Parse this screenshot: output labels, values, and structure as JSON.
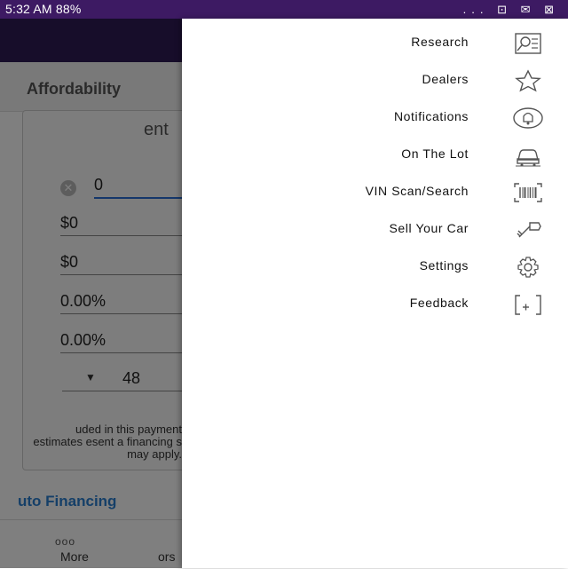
{
  "status_bar": {
    "time": "5:32 AM",
    "battery": "88%",
    "right_icons": "... ⊡ ✉ ⊠"
  },
  "tabs": {
    "affordability": "Affordability"
  },
  "card": {
    "title": "ent",
    "input_value": "0",
    "fields": [
      "$0",
      "$0",
      "0.00%",
      "0.00%"
    ],
    "term": "48"
  },
  "disclaimer": "uded in this payment estimates esent a financing s may apply.",
  "financing_link": "uto Financing",
  "bottom_nav": {
    "more_label": "More",
    "more_dots": "ooo",
    "ors_label": "ors"
  },
  "drawer": {
    "items": [
      {
        "label": "Research",
        "icon": "research-icon"
      },
      {
        "label": "Dealers",
        "icon": "star-icon"
      },
      {
        "label": "Notifications",
        "icon": "bell-icon"
      },
      {
        "label": "On The Lot",
        "icon": "car-lot-icon"
      },
      {
        "label": "VIN Scan/Search",
        "icon": "barcode-icon"
      },
      {
        "label": "Sell Your Car",
        "icon": "key-icon"
      },
      {
        "label": "Settings",
        "icon": "gear-icon"
      },
      {
        "label": "Feedback",
        "icon": "feedback-icon"
      }
    ]
  },
  "colors": {
    "status_bar": "#3d1a63",
    "header": "#2f1a55",
    "link": "#2a7fd0"
  }
}
